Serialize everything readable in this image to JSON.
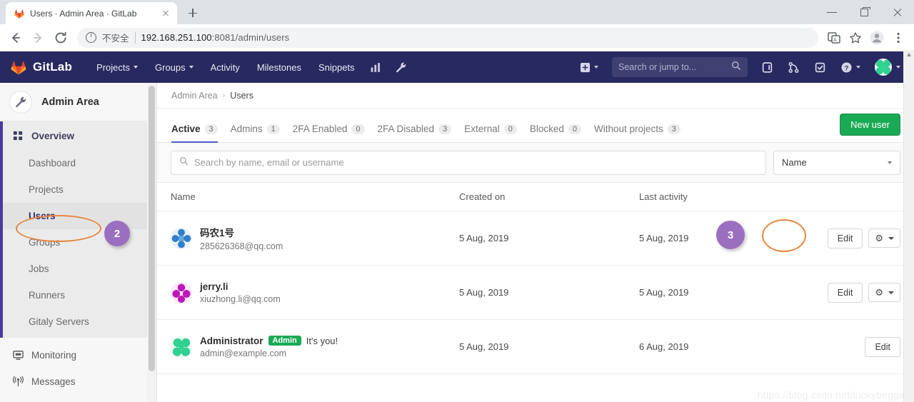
{
  "browser": {
    "tab_title": "Users · Admin Area · GitLab",
    "insecure_label": "不安全",
    "url_host": "192.168.251.100",
    "url_rest": ":8081/admin/users",
    "icons": {
      "back": "back-arrow-icon",
      "forward": "forward-arrow-icon",
      "reload": "reload-icon",
      "translate": "translate-icon",
      "bookmark": "star-icon",
      "profile": "profile-avatar-icon",
      "menu": "three-dot-menu-icon"
    }
  },
  "navbar": {
    "brand": "GitLab",
    "links": [
      {
        "label": "Projects",
        "has_caret": true
      },
      {
        "label": "Groups",
        "has_caret": true
      },
      {
        "label": "Activity",
        "has_caret": false
      },
      {
        "label": "Milestones",
        "has_caret": false
      },
      {
        "label": "Snippets",
        "has_caret": false
      }
    ],
    "search_placeholder": "Search or jump to..."
  },
  "annotations": [
    {
      "id": "1",
      "target": "admin-area-wrench-icon"
    },
    {
      "id": "2",
      "target": "sidebar-item-users"
    },
    {
      "id": "3",
      "target": "edit-user-button-row-1"
    }
  ],
  "sidebar": {
    "title": "Admin Area",
    "overview_label": "Overview",
    "items": [
      {
        "label": "Dashboard",
        "active": false
      },
      {
        "label": "Projects",
        "active": false
      },
      {
        "label": "Users",
        "active": true
      },
      {
        "label": "Groups",
        "active": false
      },
      {
        "label": "Jobs",
        "active": false
      },
      {
        "label": "Runners",
        "active": false
      },
      {
        "label": "Gitaly Servers",
        "active": false
      }
    ],
    "bottom_items": [
      {
        "label": "Monitoring",
        "icon": "monitor-icon"
      },
      {
        "label": "Messages",
        "icon": "broadcast-icon"
      }
    ]
  },
  "breadcrumb": {
    "root": "Admin Area",
    "separator": "›",
    "current": "Users"
  },
  "tabs": [
    {
      "label": "Active",
      "count": "3",
      "active": true
    },
    {
      "label": "Admins",
      "count": "1",
      "active": false
    },
    {
      "label": "2FA Enabled",
      "count": "0",
      "active": false
    },
    {
      "label": "2FA Disabled",
      "count": "3",
      "active": false
    },
    {
      "label": "External",
      "count": "0",
      "active": false
    },
    {
      "label": "Blocked",
      "count": "0",
      "active": false
    },
    {
      "label": "Without projects",
      "count": "3",
      "active": false
    }
  ],
  "new_user_button": "New user",
  "filter": {
    "search_placeholder": "Search by name, email or username",
    "sort_value": "Name"
  },
  "table": {
    "headers": {
      "name": "Name",
      "created_on": "Created on",
      "last_activity": "Last activity"
    },
    "rows": [
      {
        "name": "码农1号",
        "email": "285626368@qq.com",
        "created_on": "5 Aug, 2019",
        "last_activity": "5 Aug, 2019",
        "edit_label": "Edit",
        "badge": "",
        "note": "",
        "has_gear": true,
        "avatar": "identicon-blue"
      },
      {
        "name": "jerry.li",
        "email": "xiuzhong.li@qq.com",
        "created_on": "5 Aug, 2019",
        "last_activity": "5 Aug, 2019",
        "edit_label": "Edit",
        "badge": "",
        "note": "",
        "has_gear": true,
        "avatar": "identicon-magenta"
      },
      {
        "name": "Administrator",
        "email": "admin@example.com",
        "created_on": "5 Aug, 2019",
        "last_activity": "6 Aug, 2019",
        "edit_label": "Edit",
        "badge": "Admin",
        "note": "It's you!",
        "has_gear": false,
        "avatar": "identicon-green"
      }
    ]
  },
  "watermark": "https://blog.csdn.net/luckybeggar",
  "colors": {
    "nav_bg": "#292961",
    "accent_green": "#1aaa55",
    "highlight_orange": "#e8863c",
    "marker_purple": "#9b6fc0",
    "tab_underline": "#4b5ec4"
  }
}
